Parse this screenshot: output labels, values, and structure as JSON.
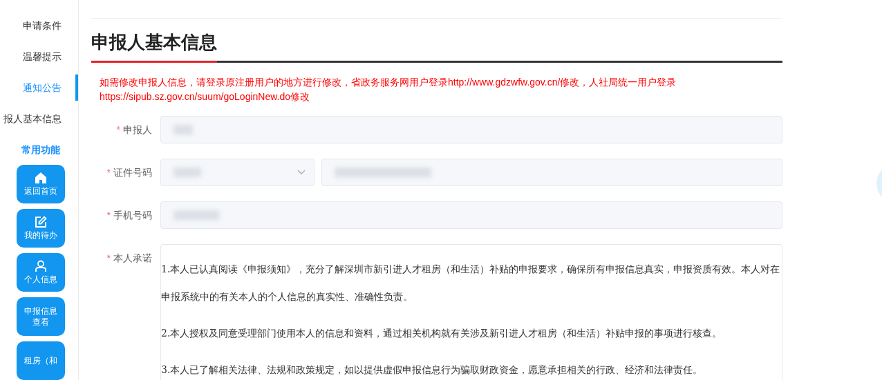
{
  "sidebar": {
    "nav_items": [
      {
        "label": "申请条件",
        "selected": false
      },
      {
        "label": "温馨提示",
        "selected": false
      },
      {
        "label": "通知公告",
        "selected": true
      },
      {
        "label": "报人基本信息",
        "selected": false
      }
    ],
    "section_title": "常用功能",
    "quick_buttons": [
      {
        "label": "返回首页",
        "kind": "home"
      },
      {
        "label": "我的待办",
        "kind": "edit"
      },
      {
        "label": "个人信息",
        "kind": "user"
      },
      {
        "label": "申报信息查看",
        "kind": "text"
      },
      {
        "label": "租房（和",
        "kind": "text"
      }
    ]
  },
  "main": {
    "title": "申报人基本信息",
    "notice": "如需修改申报人信息，请登录原注册用户的地方进行修改，省政务服务网用户登录http://www.gdzwfw.gov.cn/修改，人社局统一用户登录https://sipub.sz.gov.cn/suum/goLoginNew.do修改",
    "fields": [
      {
        "label": "申报人",
        "marker": "*",
        "kind": "text"
      },
      {
        "label": "证件号码",
        "marker": "*",
        "kind": "id"
      },
      {
        "label": "手机号码",
        "marker": "*",
        "kind": "text"
      },
      {
        "label": "本人承诺",
        "marker": "*",
        "kind": "textarea",
        "paragraphs": [
          "1.本人已认真阅读《申报须知》，充分了解深圳市新引进人才租房（和生活）补贴的申报要求，确保所有申报信息真实，申报资质有效。本人对在申报系统中的有关本人的个人信息的真实性、准确性负责。",
          "2.本人授权及同意受理部门使用本人的信息和资料，通过相关机构就有关涉及新引进人才租房（和生活）补贴申报的事项进行核查。",
          "3.本人已了解相关法律、法规和政策规定，如以提供虚假申报信息行为骗取财政资金，愿意承担相关的行政、经济和法律责任。"
        ]
      }
    ]
  }
}
